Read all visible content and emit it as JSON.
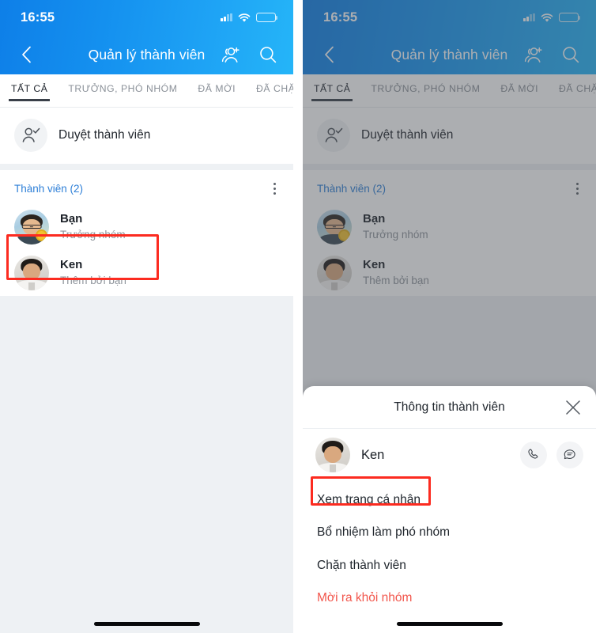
{
  "status_bar": {
    "time": "16:55",
    "icons": [
      "cellular-signal-icon",
      "wifi-icon",
      "battery-icon"
    ]
  },
  "nav": {
    "title": "Quản lý thành viên",
    "back_icon": "chevron-left-icon",
    "add_member_icon": "add-people-icon",
    "search_icon": "search-icon"
  },
  "tabs": [
    {
      "label": "TẤT CẢ",
      "active": true
    },
    {
      "label": "TRƯỞNG, PHÓ NHÓM",
      "active": false
    },
    {
      "label": "ĐÃ MỜI",
      "active": false
    },
    {
      "label": "ĐÃ CHẶN",
      "active": false
    }
  ],
  "approve": {
    "label": "Duyệt thành viên",
    "icon": "approve-member-icon"
  },
  "members_section": {
    "title": "Thành viên (2)",
    "more_icon": "kebab-menu-icon",
    "items": [
      {
        "name": "Bạn",
        "subtitle": "Trưởng nhóm",
        "avatar": "avatar-you"
      },
      {
        "name": "Ken",
        "subtitle": "Thêm bởi bạn",
        "avatar": "avatar-ken"
      }
    ]
  },
  "sheet": {
    "title": "Thông tin thành viên",
    "close_icon": "close-icon",
    "user": {
      "name": "Ken",
      "avatar": "avatar-ken",
      "call_icon": "phone-icon",
      "message_icon": "message-icon"
    },
    "menu": [
      {
        "label": "Xem trang cá nhân",
        "danger": false,
        "highlighted": true
      },
      {
        "label": "Bổ nhiệm làm phó nhóm",
        "danger": false,
        "highlighted": false
      },
      {
        "label": "Chặn thành viên",
        "danger": false,
        "highlighted": false
      },
      {
        "label": "Mời ra khỏi nhóm",
        "danger": true,
        "highlighted": false
      }
    ]
  },
  "colors": {
    "header_gradient_start": "#0e7fe8",
    "header_gradient_end": "#25b5f8",
    "accent_blue": "#2f80d8",
    "danger_red": "#f2564c",
    "highlight_red": "#fc2b20",
    "page_bg": "#eef1f4"
  }
}
